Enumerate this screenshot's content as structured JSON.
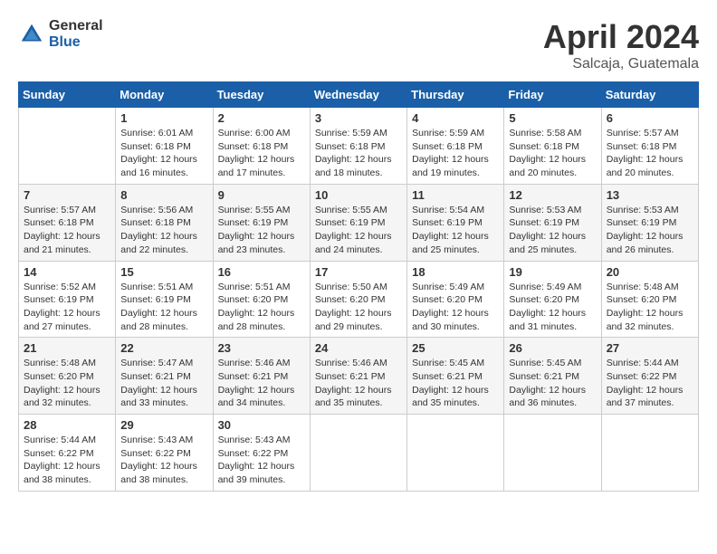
{
  "header": {
    "logo_line1": "General",
    "logo_line2": "Blue",
    "month": "April 2024",
    "location": "Salcaja, Guatemala"
  },
  "weekdays": [
    "Sunday",
    "Monday",
    "Tuesday",
    "Wednesday",
    "Thursday",
    "Friday",
    "Saturday"
  ],
  "weeks": [
    [
      {
        "day": "",
        "info": ""
      },
      {
        "day": "1",
        "info": "Sunrise: 6:01 AM\nSunset: 6:18 PM\nDaylight: 12 hours\nand 16 minutes."
      },
      {
        "day": "2",
        "info": "Sunrise: 6:00 AM\nSunset: 6:18 PM\nDaylight: 12 hours\nand 17 minutes."
      },
      {
        "day": "3",
        "info": "Sunrise: 5:59 AM\nSunset: 6:18 PM\nDaylight: 12 hours\nand 18 minutes."
      },
      {
        "day": "4",
        "info": "Sunrise: 5:59 AM\nSunset: 6:18 PM\nDaylight: 12 hours\nand 19 minutes."
      },
      {
        "day": "5",
        "info": "Sunrise: 5:58 AM\nSunset: 6:18 PM\nDaylight: 12 hours\nand 20 minutes."
      },
      {
        "day": "6",
        "info": "Sunrise: 5:57 AM\nSunset: 6:18 PM\nDaylight: 12 hours\nand 20 minutes."
      }
    ],
    [
      {
        "day": "7",
        "info": "Sunrise: 5:57 AM\nSunset: 6:18 PM\nDaylight: 12 hours\nand 21 minutes."
      },
      {
        "day": "8",
        "info": "Sunrise: 5:56 AM\nSunset: 6:18 PM\nDaylight: 12 hours\nand 22 minutes."
      },
      {
        "day": "9",
        "info": "Sunrise: 5:55 AM\nSunset: 6:19 PM\nDaylight: 12 hours\nand 23 minutes."
      },
      {
        "day": "10",
        "info": "Sunrise: 5:55 AM\nSunset: 6:19 PM\nDaylight: 12 hours\nand 24 minutes."
      },
      {
        "day": "11",
        "info": "Sunrise: 5:54 AM\nSunset: 6:19 PM\nDaylight: 12 hours\nand 25 minutes."
      },
      {
        "day": "12",
        "info": "Sunrise: 5:53 AM\nSunset: 6:19 PM\nDaylight: 12 hours\nand 25 minutes."
      },
      {
        "day": "13",
        "info": "Sunrise: 5:53 AM\nSunset: 6:19 PM\nDaylight: 12 hours\nand 26 minutes."
      }
    ],
    [
      {
        "day": "14",
        "info": "Sunrise: 5:52 AM\nSunset: 6:19 PM\nDaylight: 12 hours\nand 27 minutes."
      },
      {
        "day": "15",
        "info": "Sunrise: 5:51 AM\nSunset: 6:19 PM\nDaylight: 12 hours\nand 28 minutes."
      },
      {
        "day": "16",
        "info": "Sunrise: 5:51 AM\nSunset: 6:20 PM\nDaylight: 12 hours\nand 28 minutes."
      },
      {
        "day": "17",
        "info": "Sunrise: 5:50 AM\nSunset: 6:20 PM\nDaylight: 12 hours\nand 29 minutes."
      },
      {
        "day": "18",
        "info": "Sunrise: 5:49 AM\nSunset: 6:20 PM\nDaylight: 12 hours\nand 30 minutes."
      },
      {
        "day": "19",
        "info": "Sunrise: 5:49 AM\nSunset: 6:20 PM\nDaylight: 12 hours\nand 31 minutes."
      },
      {
        "day": "20",
        "info": "Sunrise: 5:48 AM\nSunset: 6:20 PM\nDaylight: 12 hours\nand 32 minutes."
      }
    ],
    [
      {
        "day": "21",
        "info": "Sunrise: 5:48 AM\nSunset: 6:20 PM\nDaylight: 12 hours\nand 32 minutes."
      },
      {
        "day": "22",
        "info": "Sunrise: 5:47 AM\nSunset: 6:21 PM\nDaylight: 12 hours\nand 33 minutes."
      },
      {
        "day": "23",
        "info": "Sunrise: 5:46 AM\nSunset: 6:21 PM\nDaylight: 12 hours\nand 34 minutes."
      },
      {
        "day": "24",
        "info": "Sunrise: 5:46 AM\nSunset: 6:21 PM\nDaylight: 12 hours\nand 35 minutes."
      },
      {
        "day": "25",
        "info": "Sunrise: 5:45 AM\nSunset: 6:21 PM\nDaylight: 12 hours\nand 35 minutes."
      },
      {
        "day": "26",
        "info": "Sunrise: 5:45 AM\nSunset: 6:21 PM\nDaylight: 12 hours\nand 36 minutes."
      },
      {
        "day": "27",
        "info": "Sunrise: 5:44 AM\nSunset: 6:22 PM\nDaylight: 12 hours\nand 37 minutes."
      }
    ],
    [
      {
        "day": "28",
        "info": "Sunrise: 5:44 AM\nSunset: 6:22 PM\nDaylight: 12 hours\nand 38 minutes."
      },
      {
        "day": "29",
        "info": "Sunrise: 5:43 AM\nSunset: 6:22 PM\nDaylight: 12 hours\nand 38 minutes."
      },
      {
        "day": "30",
        "info": "Sunrise: 5:43 AM\nSunset: 6:22 PM\nDaylight: 12 hours\nand 39 minutes."
      },
      {
        "day": "",
        "info": ""
      },
      {
        "day": "",
        "info": ""
      },
      {
        "day": "",
        "info": ""
      },
      {
        "day": "",
        "info": ""
      }
    ]
  ]
}
